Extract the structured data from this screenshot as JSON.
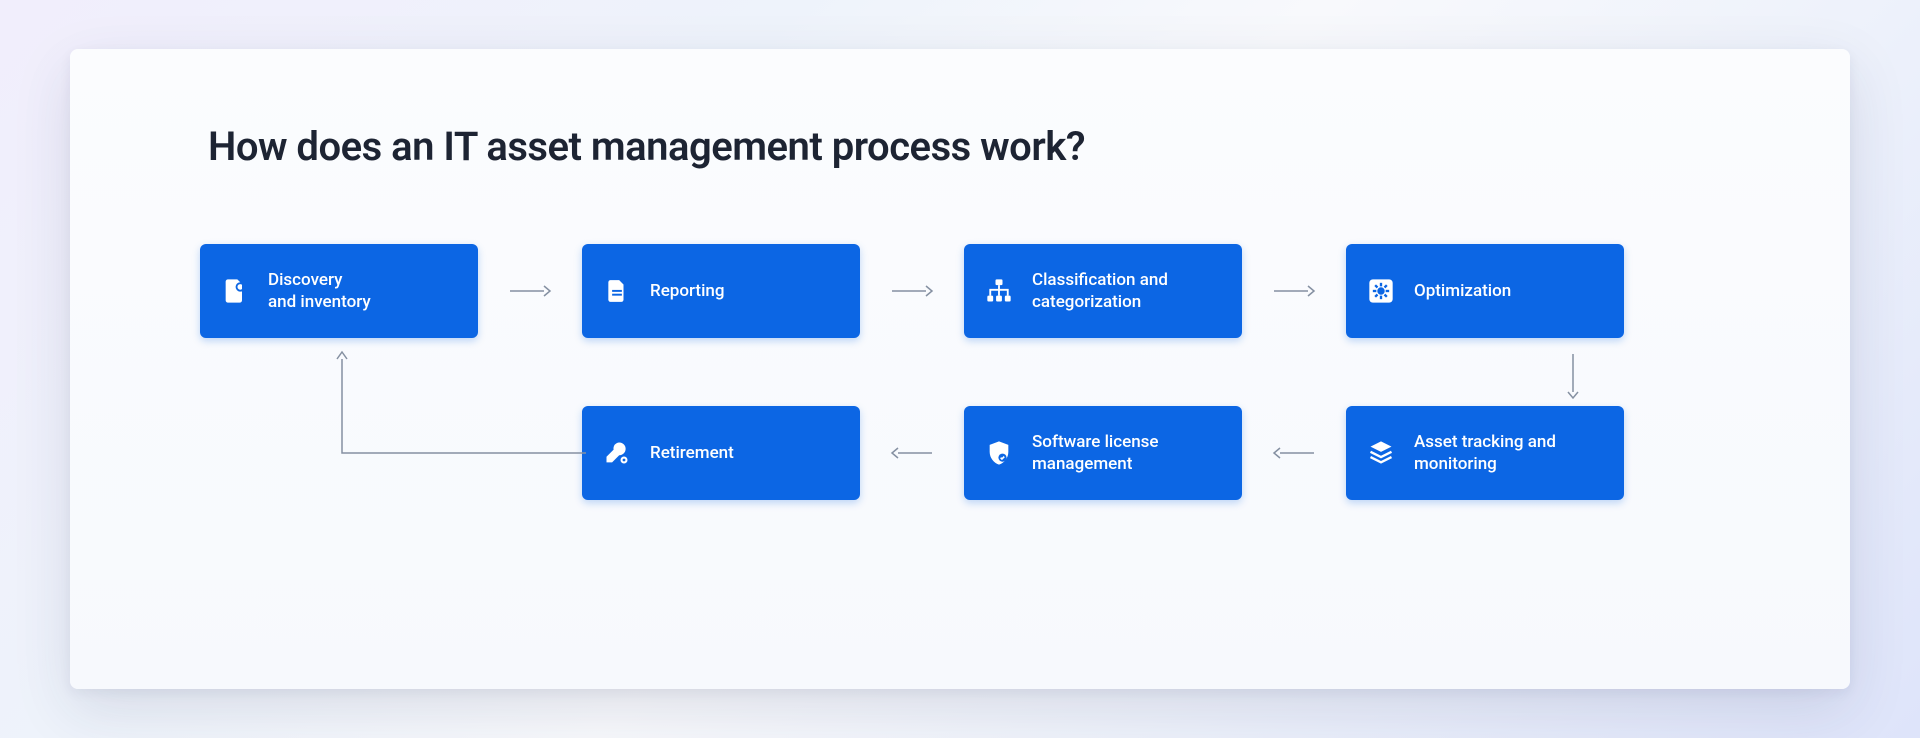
{
  "title": "How does an IT asset management process work?",
  "accent_color": "#0c66e4",
  "arrow_color": "#8590a2",
  "steps": [
    {
      "icon": "search-doc-icon",
      "label": "Discovery\nand inventory"
    },
    {
      "icon": "document-icon",
      "label": "Reporting"
    },
    {
      "icon": "hierarchy-icon",
      "label": "Classification and categorization"
    },
    {
      "icon": "gear-box-icon",
      "label": "Optimization"
    },
    {
      "icon": "layers-icon",
      "label": "Asset tracking and monitoring"
    },
    {
      "icon": "shield-icon",
      "label": "Software license management"
    },
    {
      "icon": "wrench-gear-icon",
      "label": "Retirement"
    }
  ]
}
